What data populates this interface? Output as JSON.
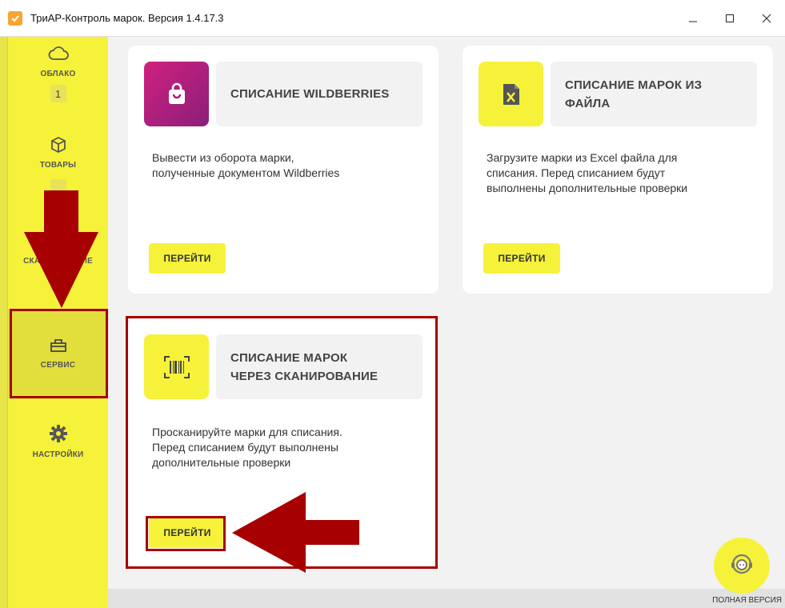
{
  "window": {
    "title": "ТриАР-Контроль марок. Версия 1.4.17.3",
    "app_icon": "checkmark-icon",
    "controls": [
      "minimize-icon",
      "maximize-icon",
      "close-icon"
    ]
  },
  "sidebar": {
    "items": [
      {
        "label": "ОБЛАКО",
        "icon": "cloud-icon",
        "badge": "1"
      },
      {
        "label": "ТОВАРЫ",
        "icon": "box-icon"
      },
      {
        "label": "СКАНИРОВАНИЕ",
        "icon": "scan-icon"
      },
      {
        "label": "СЕРВИС",
        "icon": "toolbox-icon"
      },
      {
        "label": "НАСТРОЙКИ",
        "icon": "gear-icon"
      }
    ]
  },
  "cards": [
    {
      "title": "СПИСАНИЕ WILDBERRIES",
      "description_lines": [
        "Вывести из оборота марки,",
        "полученные документом Wildberries"
      ],
      "button": "ПЕРЕЙТИ",
      "icon": "shopping-bag-icon",
      "icon_color": "#b0187f"
    },
    {
      "title_lines": [
        "СПИСАНИЕ МАРОК ИЗ",
        "ФАЙЛА"
      ],
      "description_lines": [
        "Загрузите марки из Excel файла для",
        "списания. Перед списанием будут",
        "выполнены дополнительные проверки"
      ],
      "button": "ПЕРЕЙТИ",
      "icon": "excel-file-icon",
      "icon_color": "#f6f23a"
    },
    {
      "title_lines": [
        "СПИСАНИЕ МАРОК",
        "ЧЕРЕЗ СКАНИРОВАНИЕ"
      ],
      "description_lines": [
        "Просканируйте марки для списания.",
        "Перед списанием будут выполнены",
        "дополнительные проверки"
      ],
      "button": "ПЕРЕЙТИ",
      "icon": "barcode-scan-icon",
      "icon_color": "#f6f23a"
    }
  ],
  "status": {
    "text": "ПОЛНАЯ ВЕРСИЯ"
  },
  "help_button": {
    "icon": "support-icon"
  },
  "colors": {
    "accent": "#f6f23a",
    "annotation": "#a60000"
  }
}
